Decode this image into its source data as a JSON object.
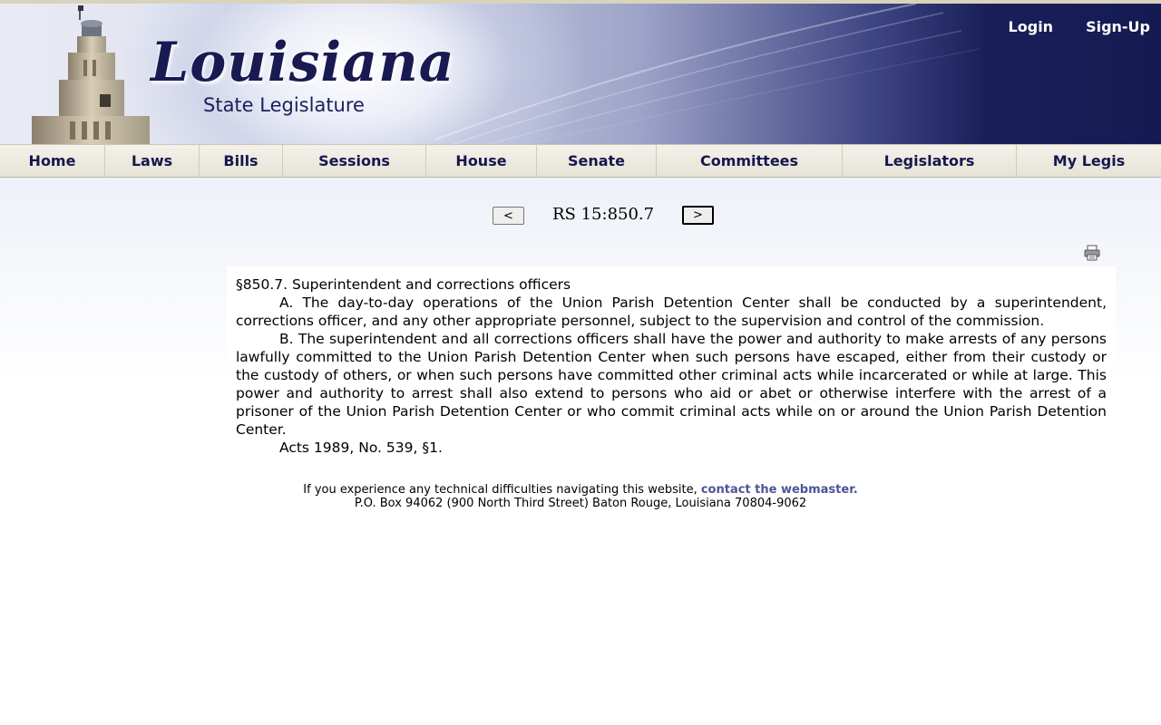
{
  "header": {
    "logo_script": "Louisiana",
    "logo_sub": "State Legislature",
    "login": "Login",
    "signup": "Sign-Up"
  },
  "nav": {
    "items": [
      {
        "label": "Home"
      },
      {
        "label": "Laws"
      },
      {
        "label": "Bills"
      },
      {
        "label": "Sessions"
      },
      {
        "label": "House"
      },
      {
        "label": "Senate"
      },
      {
        "label": "Committees"
      },
      {
        "label": "Legislators"
      },
      {
        "label": "My Legis"
      }
    ]
  },
  "docnav": {
    "prev": "<",
    "title": "RS 15:850.7",
    "next": ">"
  },
  "icons": {
    "print": "printer-icon"
  },
  "document": {
    "heading": "§850.7.  Superintendent and corrections officers",
    "para_a": "A.  The day-to-day operations of the Union Parish Detention Center shall be conducted by a superintendent, corrections officer, and any other appropriate personnel, subject to the supervision and control of the commission.",
    "para_b": "B.  The superintendent and all corrections officers shall have the power and authority to make arrests of any persons lawfully committed to the Union Parish Detention Center when such persons have escaped, either from their custody or the custody of others, or when such persons have committed other criminal acts while incarcerated or while at large.  This power and authority to arrest shall also extend to persons who aid or abet or otherwise interfere with the arrest of a prisoner of the Union Parish Detention Center or who commit criminal acts while on or around the Union Parish Detention Center.",
    "history": "Acts 1989, No. 539, §1."
  },
  "footer": {
    "text": "If you experience any technical difficulties navigating this website, ",
    "link": "contact the webmaster.",
    "address": "P.O. Box 94062 (900 North Third Street) Baton Rouge, Louisiana 70804-9062"
  },
  "colors": {
    "banner_dark": "#151a52",
    "nav_text": "#17174d",
    "link": "#4b5596"
  }
}
